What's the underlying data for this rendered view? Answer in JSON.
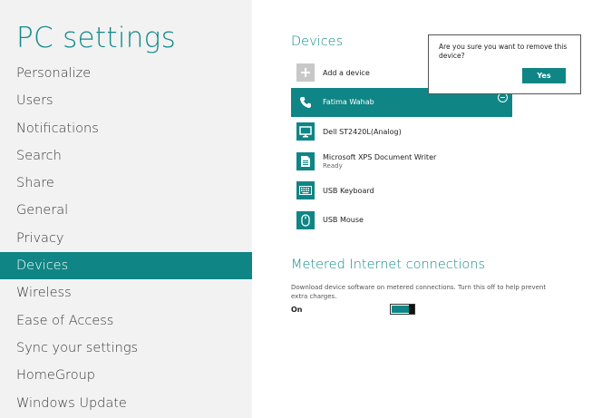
{
  "sidebar": {
    "title": "PC settings",
    "items": [
      {
        "label": "Personalize"
      },
      {
        "label": "Users"
      },
      {
        "label": "Notifications"
      },
      {
        "label": "Search"
      },
      {
        "label": "Share"
      },
      {
        "label": "General"
      },
      {
        "label": "Privacy"
      },
      {
        "label": "Devices"
      },
      {
        "label": "Wireless"
      },
      {
        "label": "Ease of Access"
      },
      {
        "label": "Sync your settings"
      },
      {
        "label": "HomeGroup"
      },
      {
        "label": "Windows Update"
      }
    ],
    "selected": "Devices"
  },
  "devices": {
    "title": "Devices",
    "items": [
      {
        "name": "Add a device",
        "icon": "plus-icon"
      },
      {
        "name": "Fatima Wahab",
        "icon": "phone-icon",
        "selected": true
      },
      {
        "name": "Dell ST2420L(Analog)",
        "icon": "monitor-icon"
      },
      {
        "name": "Microsoft XPS Document Writer",
        "status": "Ready",
        "icon": "printer-icon"
      },
      {
        "name": "USB Keyboard",
        "icon": "keyboard-icon"
      },
      {
        "name": "USB Mouse",
        "icon": "mouse-icon"
      }
    ]
  },
  "metered": {
    "title": "Metered Internet connections",
    "description": "Download device software on metered connections. Turn this off to help prevent extra charges.",
    "toggle_label": "On",
    "toggle_on": true
  },
  "flyout": {
    "message": "Are you sure you want to remove this device?",
    "confirm_label": "Yes"
  },
  "colors": {
    "accent": "#0f8585",
    "sidebar_bg": "#f2f2f2"
  }
}
